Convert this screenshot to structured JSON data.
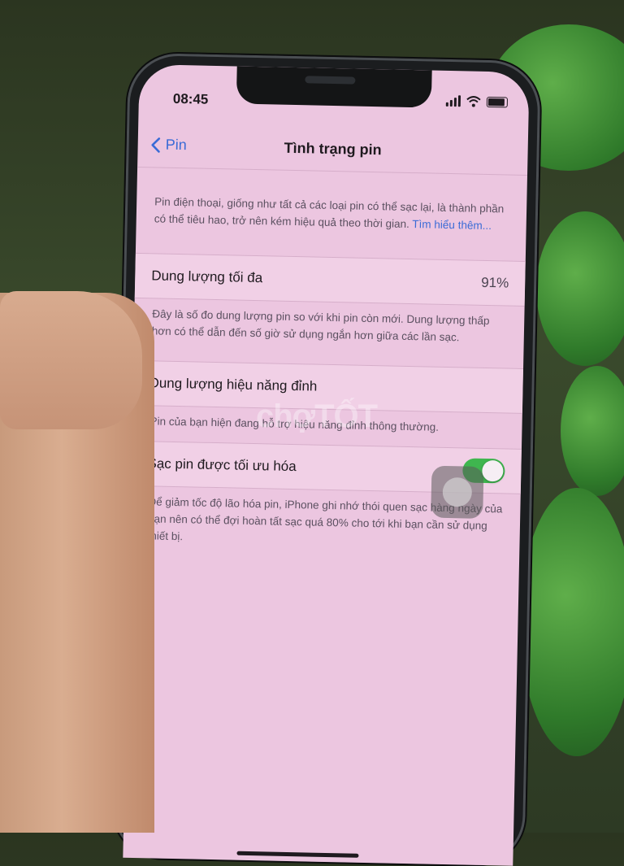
{
  "status": {
    "time": "08:45"
  },
  "nav": {
    "back_label": "Pin",
    "title": "Tình trạng pin"
  },
  "intro": {
    "text": "Pin điện thoại, giống như tất cả các loại pin có thể sạc lại, là thành phần có thể tiêu hao, trở nên kém hiệu quả theo thời gian.",
    "link": "Tìm hiểu thêm..."
  },
  "max_capacity": {
    "label": "Dung lượng tối đa",
    "value": "91%",
    "footer": "Đây là số đo dung lượng pin so với khi pin còn mới. Dung lượng thấp hơn có thể dẫn đến số giờ sử dụng ngắn hơn giữa các lần sạc."
  },
  "peak_performance": {
    "label": "Dung lượng hiệu năng đỉnh",
    "footer": "Pin của bạn hiện đang hỗ trợ hiệu năng đỉnh thông thường."
  },
  "optimized_charging": {
    "label": "Sạc pin được tối ưu hóa",
    "enabled": true,
    "footer": "Để giảm tốc độ lão hóa pin, iPhone ghi nhớ thói quen sạc hàng ngày của bạn nên có thể đợi hoàn tất sạc quá 80% cho tới khi bạn cần sử dụng thiết bị."
  },
  "watermark": "chợTỐT",
  "colors": {
    "accent": "#3a6bd6",
    "toggle_on": "#3fb64f",
    "screen_bg": "#ecc6e0"
  }
}
